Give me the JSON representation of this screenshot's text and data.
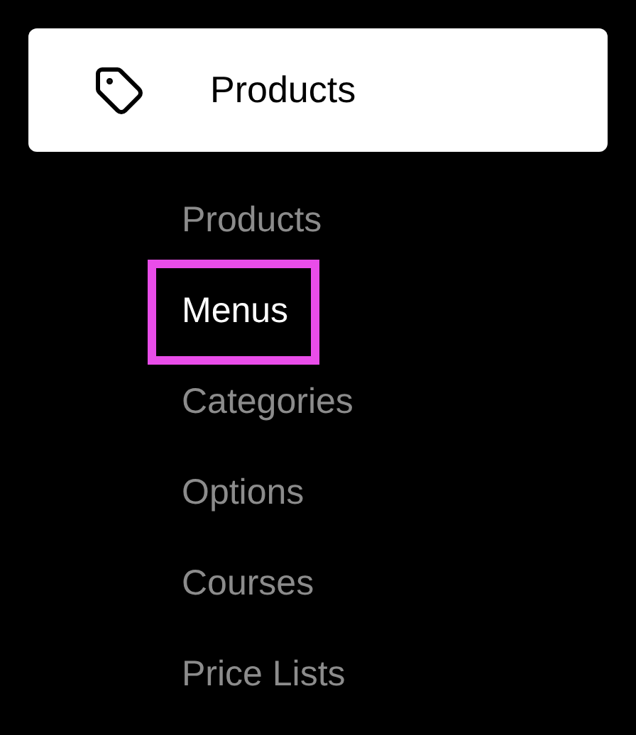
{
  "header": {
    "label": "Products"
  },
  "items": [
    {
      "label": "Products",
      "selected": false
    },
    {
      "label": "Menus",
      "selected": true
    },
    {
      "label": "Categories",
      "selected": false
    },
    {
      "label": "Options",
      "selected": false
    },
    {
      "label": "Courses",
      "selected": false
    },
    {
      "label": "Price Lists",
      "selected": false
    }
  ]
}
